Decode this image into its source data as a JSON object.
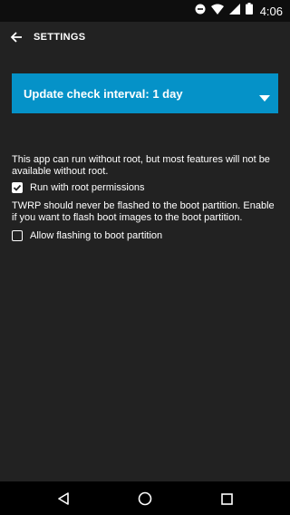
{
  "status_bar": {
    "time": "4:06",
    "icons": [
      "do-not-disturb-icon",
      "wifi-icon",
      "signal-icon",
      "battery-icon"
    ]
  },
  "toolbar": {
    "back_icon": "arrow-back-icon",
    "title": "SETTINGS"
  },
  "update_interval": {
    "label": "Update check interval: 1 day",
    "icon": "dropdown-arrow-icon"
  },
  "root_section": {
    "description": "This app can run without root, but most features will not be available without root.",
    "checkbox_label": "Run with root permissions",
    "checked": true
  },
  "boot_section": {
    "description": "TWRP should never be flashed to the boot partition. Enable if you want to flash boot images to the boot partition.",
    "checkbox_label": "Allow flashing to boot partition",
    "checked": false
  },
  "nav_bar": {
    "icons": [
      "back-triangle-icon",
      "home-circle-icon",
      "recents-square-icon"
    ]
  },
  "colors": {
    "background": "#222222",
    "accent": "#0592c8",
    "status_bar": "#0e0e0e",
    "nav_bar": "#000000",
    "text": "#ffffff"
  }
}
